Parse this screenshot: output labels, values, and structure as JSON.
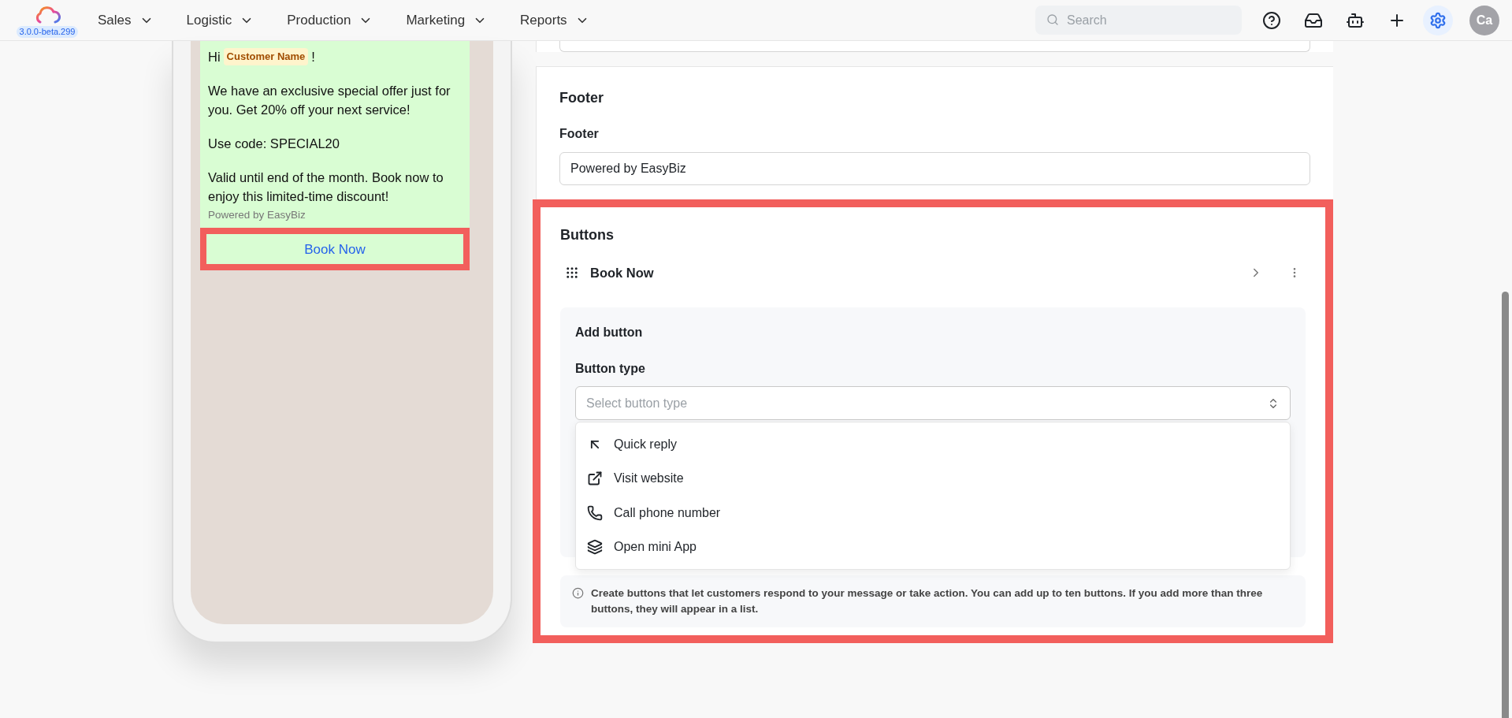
{
  "nav": {
    "version": "3.0.0-beta.299",
    "menus": [
      "Sales",
      "Logistic",
      "Production",
      "Marketing",
      "Reports"
    ],
    "search": {
      "placeholder": "Search"
    },
    "settings_active": true,
    "avatar": "Ca"
  },
  "preview": {
    "greeting": "Hi",
    "variable": "Customer Name",
    "greeting_end": "!",
    "paragraphs": [
      "We have an exclusive special offer just for you. Get 20% off your next service!",
      "Use code: SPECIAL20",
      "Valid until end of the month. Book now to enjoy this limited-time discount!"
    ],
    "footer": "Powered by EasyBiz",
    "button": {
      "label": "Book Now",
      "highlighted": true
    }
  },
  "footer_section": {
    "title": "Footer",
    "label": "Footer",
    "value": "Powered by EasyBiz"
  },
  "buttons_section": {
    "title": "Buttons",
    "highlighted": true,
    "items": [
      {
        "label": "Book Now"
      }
    ],
    "add_button": {
      "title": "Add button",
      "type_label": "Button type",
      "select": {
        "placeholder": "Select button type",
        "expanded": true
      },
      "options": [
        {
          "kind": "reply",
          "label": "Quick reply"
        },
        {
          "kind": "website",
          "label": "Visit website"
        },
        {
          "kind": "phone",
          "label": "Call phone number"
        },
        {
          "kind": "app",
          "label": "Open mini App"
        }
      ]
    },
    "info": "Create buttons that let customers respond to your message or take action. You can add up to ten buttons. If you add more than three buttons, they will appear in a list."
  }
}
